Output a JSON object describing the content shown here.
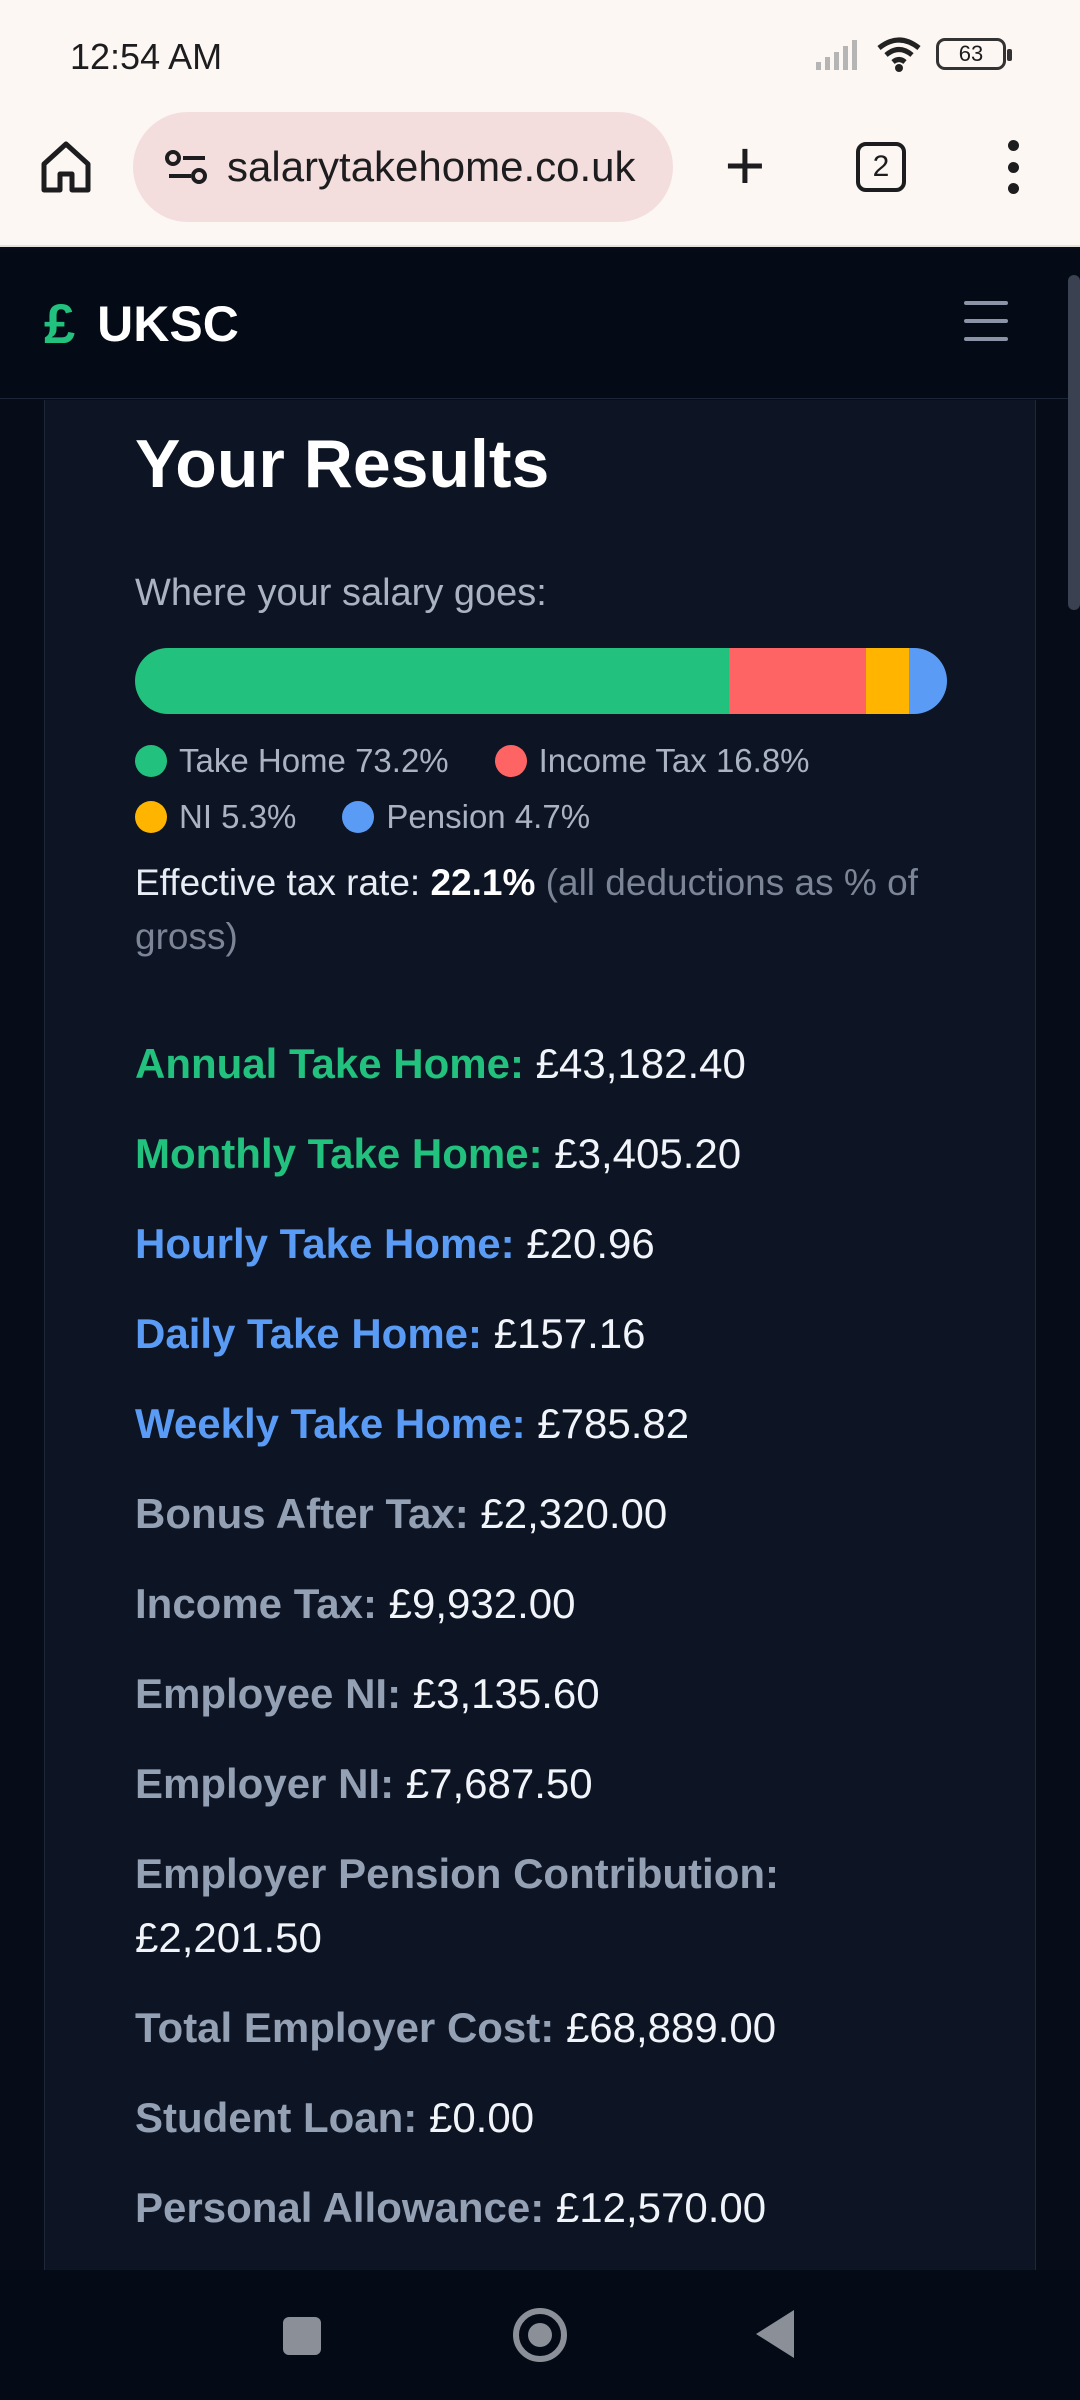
{
  "status_bar": {
    "time": "12:54 AM",
    "battery": "63"
  },
  "browser": {
    "url": "salarytakehome.co.uk",
    "tab_count": "2"
  },
  "site": {
    "logo_mark": "£",
    "logo_text": "UKSC"
  },
  "results": {
    "title": "Your Results",
    "breakdown_label": "Where your salary goes:",
    "breakdown": [
      {
        "label": "Take Home 73.2%",
        "percent": 73.2,
        "color": "#22c17d"
      },
      {
        "label": "Income Tax 16.8%",
        "percent": 16.8,
        "color": "#ff6464"
      },
      {
        "label": "NI 5.3%",
        "percent": 5.3,
        "color": "#ffb500"
      },
      {
        "label": "Pension 4.7%",
        "percent": 4.7,
        "color": "#5a9cf5"
      }
    ],
    "effective_label": "Effective tax rate:",
    "effective_value": "22.1%",
    "effective_note": "(all deductions as % of gross)",
    "rows": [
      {
        "label": "Annual Take Home:",
        "value": "£43,182.40",
        "color": "green"
      },
      {
        "label": "Monthly Take Home:",
        "value": "£3,405.20",
        "color": "green"
      },
      {
        "label": "Hourly Take Home:",
        "value": "£20.96",
        "color": "blue"
      },
      {
        "label": "Daily Take Home:",
        "value": "£157.16",
        "color": "blue"
      },
      {
        "label": "Weekly Take Home:",
        "value": "£785.82",
        "color": "blue"
      },
      {
        "label": "Bonus After Tax:",
        "value": "£2,320.00",
        "color": "grey"
      },
      {
        "label": "Income Tax:",
        "value": "£9,932.00",
        "color": "grey"
      },
      {
        "label": "Employee NI:",
        "value": "£3,135.60",
        "color": "grey"
      },
      {
        "label": "Employer NI:",
        "value": "£7,687.50",
        "color": "grey"
      },
      {
        "label": "Employer Pension Contribution:",
        "value": "£2,201.50",
        "color": "grey"
      },
      {
        "label": "Total Employer Cost:",
        "value": "£68,889.00",
        "color": "grey"
      },
      {
        "label": "Student Loan:",
        "value": "£0.00",
        "color": "grey"
      },
      {
        "label": "Personal Allowance:",
        "value": "£12,570.00",
        "color": "grey"
      }
    ]
  }
}
